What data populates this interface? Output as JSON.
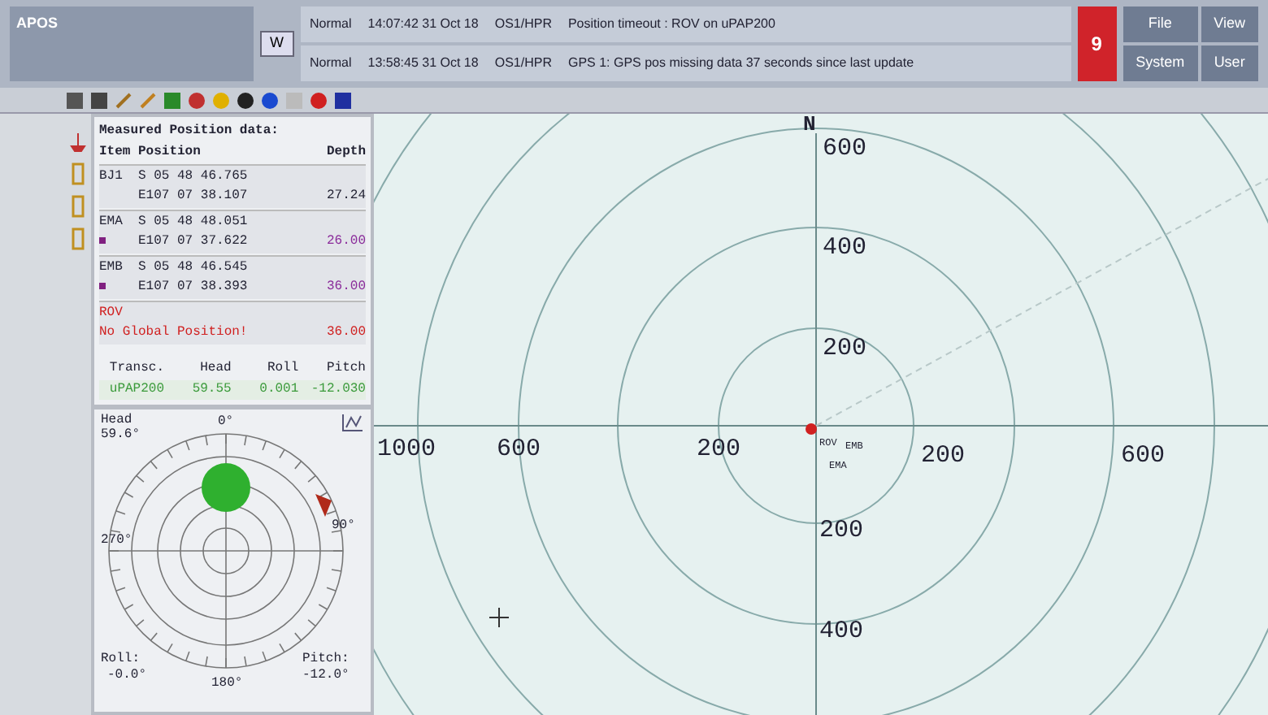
{
  "header": {
    "app": "APOS",
    "mode_button": "W",
    "alarms": [
      {
        "level": "Normal",
        "time": "14:07:42 31 Oct 18",
        "source": "OS1/HPR",
        "message": "Position timeout : ROV on uPAP200"
      },
      {
        "level": "Normal",
        "time": "13:58:45 31 Oct 18",
        "source": "OS1/HPR",
        "message": "GPS 1: GPS pos missing data 37 seconds since last update"
      }
    ],
    "alarm_count": "9",
    "menu_buttons": [
      "File",
      "View",
      "System",
      "User"
    ]
  },
  "position_panel": {
    "title": "Measured Position data:",
    "columns": [
      "Item",
      "Position",
      "Depth"
    ],
    "rows": [
      {
        "kind": "fixed",
        "item": "BJ1",
        "lat": "S 05 48 46.765",
        "lon": "E107 07 38.107",
        "depth": "27.24"
      },
      {
        "kind": "marked",
        "item": "EMA",
        "lat": "S 05 48 48.051",
        "lon": "E107 07 37.622",
        "depth": "26.00"
      },
      {
        "kind": "marked",
        "item": "EMB",
        "lat": "S 05 48 46.545",
        "lon": "E107 07 38.393",
        "depth": "36.00"
      },
      {
        "kind": "no_position",
        "item": "ROV",
        "lat": "No Global Position!",
        "lon": "",
        "depth": "36.00"
      }
    ]
  },
  "transceiver": {
    "columns": [
      "Transc.",
      "Head",
      "Roll",
      "Pitch"
    ],
    "values": [
      "uPAP200",
      "59.55",
      "0.001",
      "-12.030"
    ]
  },
  "attitude": {
    "head_label": "Head",
    "head": "59.6°",
    "north": "0°",
    "east": "90°",
    "south": "180°",
    "west": "270°",
    "roll_label": "Roll:",
    "roll": "-0.0°",
    "pitch_label": "Pitch:",
    "pitch": "-12.0°"
  },
  "plot": {
    "north": "N",
    "up_labels": [
      "600",
      "400",
      "200"
    ],
    "down_labels": [
      "200",
      "400"
    ],
    "left_labels": [
      "1000",
      "600",
      "200"
    ],
    "right_labels": [
      "200",
      "600"
    ],
    "targets": [
      "ROV",
      "EMB",
      "EMA"
    ]
  }
}
